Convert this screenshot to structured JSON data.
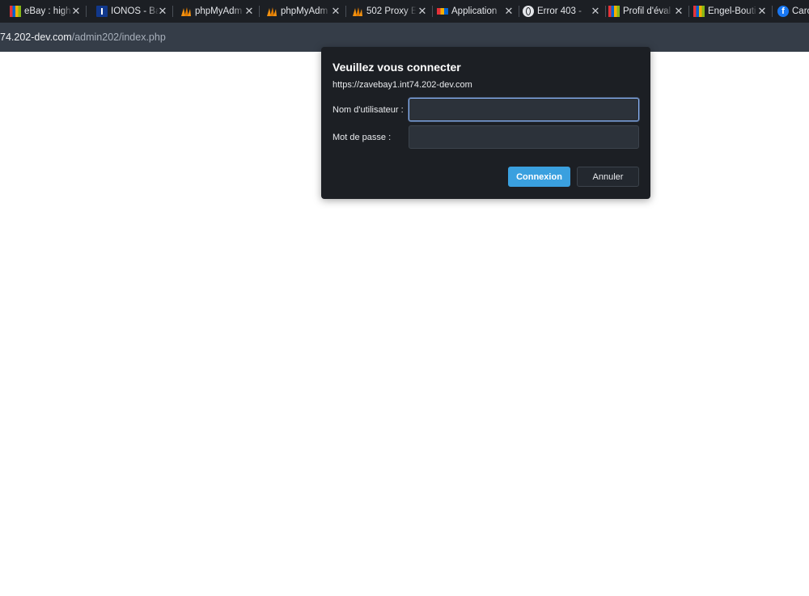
{
  "tabs": [
    {
      "title": "eBay : high",
      "icon": "ebay-favicon-icon"
    },
    {
      "title": "IONOS - Ba",
      "icon": "ionos-favicon-icon"
    },
    {
      "title": "phpMyAdm",
      "icon": "phpmyadmin-favicon-icon"
    },
    {
      "title": "phpMyAdm",
      "icon": "phpmyadmin-favicon-icon"
    },
    {
      "title": "502 Proxy E",
      "icon": "phpmyadmin-favicon-icon"
    },
    {
      "title": "Application",
      "icon": "app-favicon-icon"
    },
    {
      "title": "Error 403 - ",
      "icon": "globe-icon"
    },
    {
      "title": "Profil d'éval",
      "icon": "ebay-favicon-icon"
    },
    {
      "title": "Engel-Bouti",
      "icon": "ebay-favicon-icon"
    },
    {
      "title": "Caro",
      "icon": "facebook-icon"
    }
  ],
  "address_bar": {
    "host": "74.202-dev.com",
    "path": "/admin202/index.php"
  },
  "dialog": {
    "title": "Veuillez vous connecter",
    "origin": "https://zavebay1.int74.202-dev.com",
    "username_label": "Nom d'utilisateur :",
    "username_value": "",
    "password_label": "Mot de passe :",
    "password_value": "",
    "login_button": "Connexion",
    "cancel_button": "Annuler"
  },
  "colors": {
    "tabstrip_bg": "#1c1f24",
    "address_bg": "#353d48",
    "dialog_bg": "#1c1f24",
    "primary_button": "#3aa0df",
    "focus_ring": "#8ab4f8"
  }
}
